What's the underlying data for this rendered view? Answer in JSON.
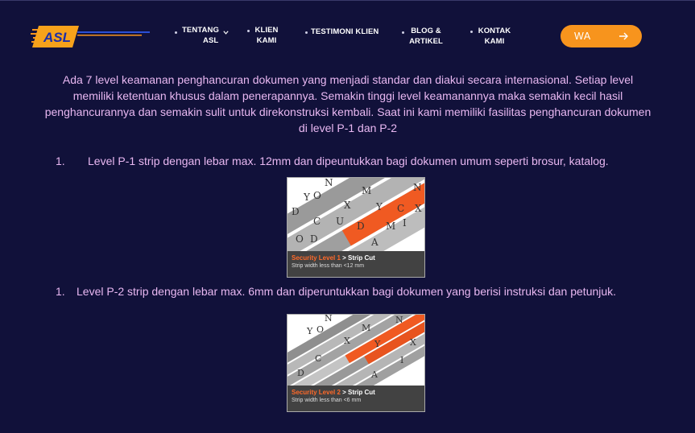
{
  "brand": {
    "logo_text": "ASL"
  },
  "nav": {
    "items": [
      {
        "line1": "TENTANG",
        "line2": "ASL"
      },
      {
        "line1": "KLIEN",
        "line2": "KAMI"
      },
      {
        "line1": "TESTIMONI KLIEN",
        "line2": ""
      },
      {
        "line1": "BLOG &",
        "line2": "ARTIKEL"
      },
      {
        "line1": "KONTAK",
        "line2": "KAMI"
      }
    ],
    "cta_label": "WA"
  },
  "content": {
    "intro": "Ada 7 level keamanan penghancuran dokumen yang menjadi standar dan diakui secara internasional. Setiap level memiliki ketentuan khusus dalam penerapannya. Semakin tinggi level keamanannya maka semakin kecil hasil penghancurannya dan semakin sulit untuk direkonstruksi kembali. Saat ini kami memiliki fasilitas penghancuran dokumen di level P-1 dan P-2",
    "levels": [
      {
        "number": "1.",
        "text": "Level P-1 strip dengan lebar max. 12mm dan dipeuntukkan bagi dokumen umum seperti brosur, katalog.",
        "caption_level": "Security Level 1",
        "caption_type": " > Strip Cut",
        "caption_desc": "Strip width less than <12 mm"
      },
      {
        "number": "1.",
        "text": "Level P-2 strip dengan lebar max. 6mm dan diperuntukkan bagi dokumen yang berisi instruksi dan petunjuk.",
        "caption_level": "Security Level 2",
        "caption_type": " > Strip Cut",
        "caption_desc": "Strip width less than <6 mm"
      }
    ]
  },
  "colors": {
    "background": "#11113a",
    "text": "#e9b8f2",
    "accent": "#f7941d",
    "shred_accent": "#ff6a2a"
  },
  "icons": [
    "chevron-down-icon",
    "arrow-right-icon"
  ]
}
